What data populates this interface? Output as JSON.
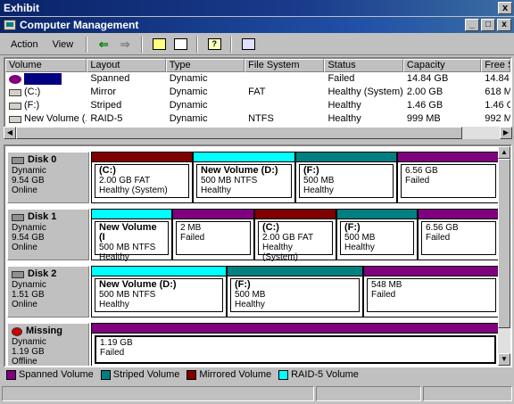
{
  "exhibit": {
    "title": "Exhibit",
    "close_label": "x"
  },
  "window": {
    "title": "Computer Management",
    "min": "_",
    "max": "□",
    "close": "x"
  },
  "menu": {
    "action": "Action",
    "view": "View"
  },
  "volume_table": {
    "headers": [
      "Volume",
      "Layout",
      "Type",
      "File System",
      "Status",
      "Capacity",
      "Free S"
    ],
    "rows": [
      {
        "volume": "",
        "layout": "Spanned",
        "type": "Dynamic",
        "fs": "",
        "status": "Failed",
        "capacity": "14.84 GB",
        "free": "14.84"
      },
      {
        "volume": "(C:)",
        "layout": "Mirror",
        "type": "Dynamic",
        "fs": "FAT",
        "status": "Healthy (System)",
        "capacity": "2.00 GB",
        "free": "618 M"
      },
      {
        "volume": "(F:)",
        "layout": "Striped",
        "type": "Dynamic",
        "fs": "",
        "status": "Healthy",
        "capacity": "1.46 GB",
        "free": "1.46 G"
      },
      {
        "volume": "New Volume (...",
        "layout": "RAID-5",
        "type": "Dynamic",
        "fs": "NTFS",
        "status": "Healthy",
        "capacity": "999 MB",
        "free": "992 M"
      }
    ]
  },
  "disks": [
    {
      "name": "Disk 0",
      "type": "Dynamic",
      "size": "9.54 GB",
      "status": "Online",
      "parts": [
        {
          "kind": "mirrored",
          "title": "(C:)",
          "line1": "2.00 GB FAT",
          "line2": "Healthy (System)"
        },
        {
          "kind": "raid",
          "title": "New Volume  (D:)",
          "line1": "500 MB NTFS",
          "line2": "Healthy"
        },
        {
          "kind": "striped",
          "title": "(F:)",
          "line1": "500 MB",
          "line2": "Healthy"
        },
        {
          "kind": "spanned",
          "title": "",
          "line1": "6.56 GB",
          "line2": "Failed"
        }
      ]
    },
    {
      "name": "Disk 1",
      "type": "Dynamic",
      "size": "9.54 GB",
      "status": "Online",
      "parts": [
        {
          "kind": "raid",
          "title": "New Volume  (I",
          "line1": "500 MB NTFS",
          "line2": "Healthy"
        },
        {
          "kind": "spanned",
          "title": "",
          "line1": "2 MB",
          "line2": "Failed"
        },
        {
          "kind": "mirrored",
          "title": "(C:)",
          "line1": "2.00 GB FAT",
          "line2": "Healthy (System)"
        },
        {
          "kind": "striped",
          "title": "(F:)",
          "line1": "500 MB",
          "line2": "Healthy"
        },
        {
          "kind": "spanned",
          "title": "",
          "line1": "6.56 GB",
          "line2": "Failed"
        }
      ]
    },
    {
      "name": "Disk 2",
      "type": "Dynamic",
      "size": "1.51 GB",
      "status": "Online",
      "parts": [
        {
          "kind": "raid",
          "title": "New Volume  (D:)",
          "line1": "500 MB NTFS",
          "line2": "Healthy"
        },
        {
          "kind": "striped",
          "title": "(F:)",
          "line1": "500 MB",
          "line2": "Healthy"
        },
        {
          "kind": "spanned",
          "title": "",
          "line1": "548 MB",
          "line2": "Failed"
        }
      ]
    },
    {
      "name": "Missing",
      "type": "Dynamic",
      "size": "1.19 GB",
      "status": "Offline",
      "parts": [
        {
          "kind": "spanned",
          "title": "",
          "line1": "1.19 GB",
          "line2": "Failed"
        }
      ]
    }
  ],
  "legend": [
    {
      "label": "Spanned Volume",
      "color": "#800080"
    },
    {
      "label": "Striped Volume",
      "color": "#008080"
    },
    {
      "label": "Mirrored Volume",
      "color": "#800000"
    },
    {
      "label": "RAID-5 Volume",
      "color": "#00ffff"
    }
  ]
}
